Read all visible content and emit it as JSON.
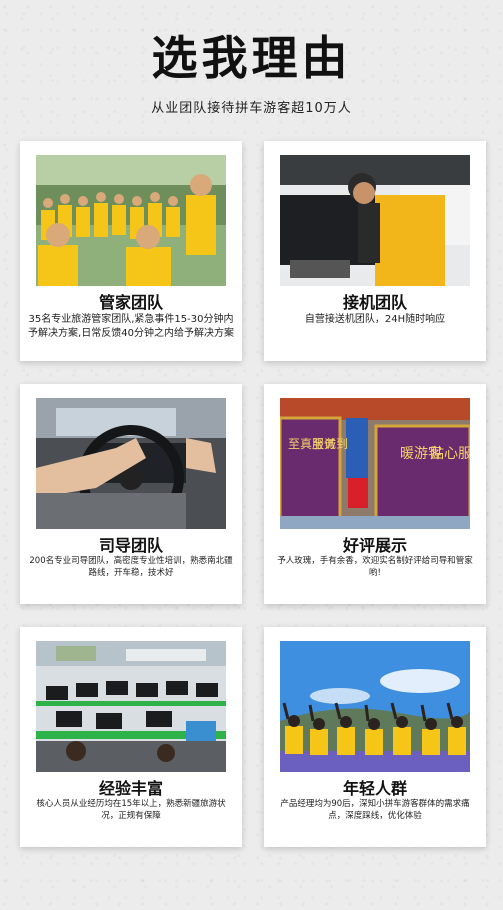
{
  "header": {
    "title": "选我理由",
    "subtitle": "从业团队接待拼车游客超10万人"
  },
  "cards": [
    {
      "title": "管家团队",
      "desc": "35名专业旅游管家团队,紧急事件15-30分钟内予解决方案,日常反馈40分钟之内给予解决方案"
    },
    {
      "title": "接机团队",
      "desc": "自营接送机团队，24H随时响应"
    },
    {
      "title": "司导团队",
      "desc": "200名专业司导团队，高密度专业性培训，熟悉南北疆路线，开车稳，技术好"
    },
    {
      "title": "好评展示",
      "desc": "予人玫瑰，手有余香，欢迎实名制好评给司导和管家哟!",
      "banner_text": [
        "至真至诚",
        "服务到",
        "贴心服务",
        "暖游客"
      ]
    },
    {
      "title": "经验丰富",
      "desc": "核心人员从业经历均在15年以上，熟悉新疆旅游状况，正规有保障"
    },
    {
      "title": "年轻人群",
      "desc": "产品经理均为90后，深知小拼车游客群体的需求痛点，深度踩线，优化体验"
    }
  ],
  "colors": {
    "accent_yellow": "#f5c518",
    "banner_purple": "#6a2a6e",
    "background": "#ececec"
  }
}
